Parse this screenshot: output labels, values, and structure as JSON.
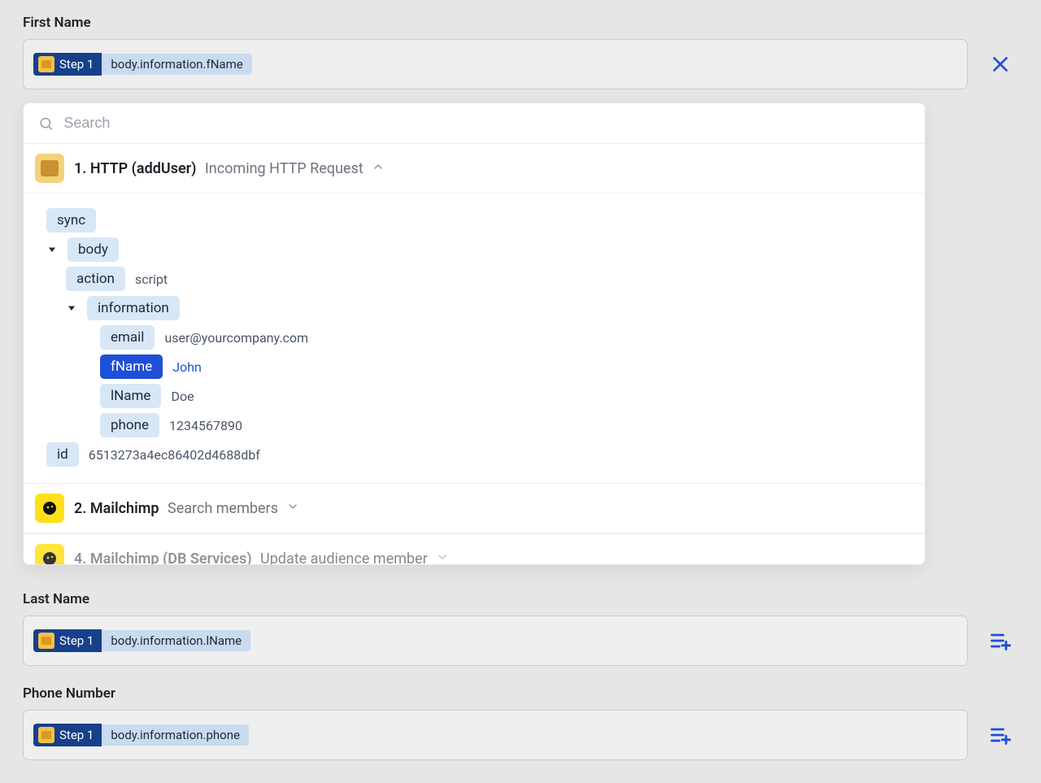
{
  "fields": {
    "firstName": {
      "label": "First Name",
      "stepLabel": "Step 1",
      "path": "body.information.fName"
    },
    "lastName": {
      "label": "Last Name",
      "stepLabel": "Step 1",
      "path": "body.information.lName"
    },
    "phone": {
      "label": "Phone Number",
      "stepLabel": "Step 1",
      "path": "body.information.phone"
    }
  },
  "dropdown": {
    "searchPlaceholder": "Search",
    "step1": {
      "titlePrefix": "1.",
      "titleName": "HTTP (addUser)",
      "subtitle": "Incoming HTTP Request"
    },
    "tree": {
      "sync": "sync",
      "body": "body",
      "action": {
        "key": "action",
        "value": "script"
      },
      "information": "information",
      "email": {
        "key": "email",
        "value": "user@yourcompany.com"
      },
      "fName": {
        "key": "fName",
        "value": "John"
      },
      "lName": {
        "key": "lName",
        "value": "Doe"
      },
      "phone": {
        "key": "phone",
        "value": "1234567890"
      },
      "id": {
        "key": "id",
        "value": "6513273a4ec86402d4688dbf"
      }
    },
    "step2": {
      "titlePrefix": "2.",
      "titleName": "Mailchimp",
      "subtitle": "Search members"
    },
    "step4": {
      "titlePrefix": "4.",
      "titleName": "Mailchimp (DB Services)",
      "subtitle": "Update audience member"
    }
  }
}
